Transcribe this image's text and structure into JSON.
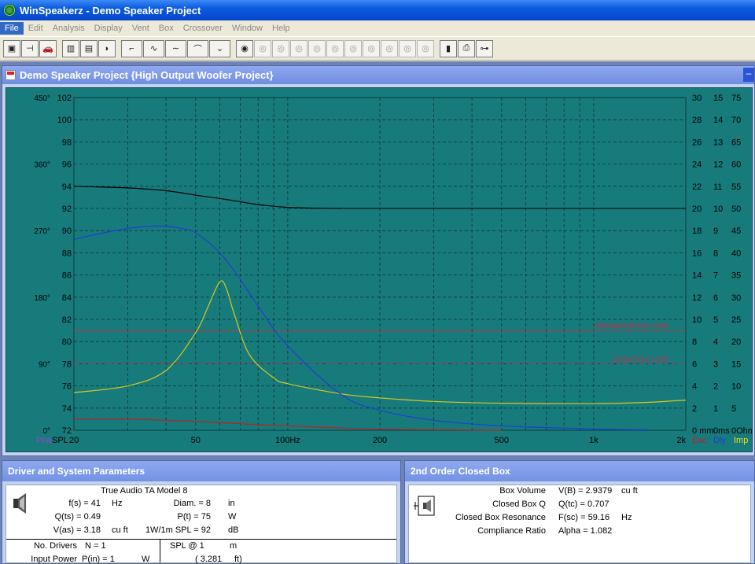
{
  "window": {
    "title": "WinSpeakerz - Demo Speaker Project"
  },
  "menu": [
    "File",
    "Edit",
    "Analysis",
    "Display",
    "Vent",
    "Box",
    "Crossover",
    "Window",
    "Help"
  ],
  "chart_window": {
    "title": "Demo Speaker Project {High Output Woofer Project}"
  },
  "chart_data": {
    "type": "line",
    "x_scale": "log",
    "xlim": [
      20,
      2000
    ],
    "x_ticks": [
      "20",
      "50",
      "100Hz",
      "200",
      "500",
      "1k",
      "2k"
    ],
    "ylim_spl": [
      72,
      102
    ],
    "y_ticks_spl": [
      "102",
      "100",
      "98",
      "96",
      "94",
      "92",
      "90",
      "88",
      "86",
      "84",
      "82",
      "80",
      "78",
      "76",
      "74",
      "72"
    ],
    "y_ticks_phase": [
      "450°",
      "360°",
      "270°",
      "180°",
      "90°",
      "0°"
    ],
    "y_ticks_exc": [
      "30",
      "28",
      "26",
      "24",
      "22",
      "20",
      "18",
      "16",
      "14",
      "12",
      "10",
      "8",
      "6",
      "4",
      "2",
      "0 mm"
    ],
    "y_ticks_dly": [
      "15",
      "14",
      "13",
      "12",
      "11",
      "10",
      "9",
      "8",
      "7",
      "6",
      "5",
      "4",
      "3",
      "2",
      "1",
      "0ms"
    ],
    "y_ticks_imp": [
      "75",
      "70",
      "65",
      "60",
      "55",
      "50",
      "45",
      "40",
      "35",
      "30",
      "25",
      "20",
      "15",
      "10",
      "5",
      "0Ohm"
    ],
    "axis_labels": {
      "phase": "Pha",
      "spl": "SPL",
      "exc": "Exc",
      "dly": "Dly",
      "imp": "Imp"
    },
    "series": [
      {
        "name": "SPL",
        "color": "#000000",
        "axis": "spl",
        "x": [
          20,
          30,
          40,
          50,
          60,
          70,
          80,
          90,
          100,
          120,
          150
        ],
        "y": [
          94.0,
          93.85,
          93.6,
          93.2,
          92.9,
          92.6,
          92.35,
          92.2,
          92.1,
          92.03,
          92.0
        ]
      },
      {
        "name": "Imp",
        "color": "#d8c81e",
        "axis": "imp",
        "x": [
          20,
          30,
          40,
          50,
          55,
          60,
          63,
          67,
          75,
          90,
          100,
          150,
          200,
          300,
          500,
          1000,
          1500,
          2000
        ],
        "y": [
          8.5,
          10.0,
          13.5,
          22.0,
          28.0,
          33.5,
          32.0,
          26.0,
          17.0,
          11.8,
          10.5,
          8.2,
          7.3,
          6.5,
          6.1,
          6.0,
          6.3,
          6.8
        ]
      },
      {
        "name": "Dly",
        "color": "#1f3fd6",
        "axis": "dly",
        "x": [
          20,
          25,
          30,
          35,
          40,
          45,
          50,
          60,
          70,
          80,
          100,
          150,
          200,
          300,
          500,
          1000,
          1500
        ],
        "y": [
          8.6,
          8.9,
          9.1,
          9.2,
          9.2,
          9.1,
          8.9,
          8.0,
          6.8,
          5.6,
          3.8,
          1.6,
          0.9,
          0.45,
          0.2,
          0.06,
          0.02
        ]
      },
      {
        "name": "Exc",
        "color": "#c02020",
        "axis": "exc",
        "x": [
          20,
          30,
          40,
          50,
          60,
          80,
          100,
          150,
          200,
          300,
          400,
          500
        ],
        "y": [
          1.0,
          1.0,
          0.9,
          0.8,
          0.7,
          0.5,
          0.4,
          0.2,
          0.1,
          0.04,
          0.02,
          0.0
        ]
      }
    ],
    "limit_lines": [
      {
        "label": "Mechanical Exc Limit",
        "axis": "exc",
        "value": 9.0,
        "color": "#c42f4a",
        "style": "solid"
      },
      {
        "label": "Linear Exc Limit",
        "axis": "exc",
        "value": 6.0,
        "color": "#c42f4a",
        "style": "dashed"
      }
    ]
  },
  "driver_panel": {
    "title": "Driver and System Parameters",
    "model": "True Audio TA Model 8",
    "fs": {
      "label": "f(s) = 41",
      "unit": "Hz"
    },
    "qts": {
      "label": "Q(ts) = 0.49"
    },
    "vas": {
      "label": "V(as) = 3.18",
      "unit": "cu ft"
    },
    "diam": {
      "label": "Diam. = 8",
      "unit": "in"
    },
    "pt": {
      "label": "P(t) = 75",
      "unit": "W"
    },
    "spl": {
      "label": "1W/1m SPL = 92",
      "unit": "dB"
    },
    "drivers": {
      "label": "No. Drivers",
      "value": "N = 1"
    },
    "power": {
      "label": "Input Power",
      "value": "P(in) = 1",
      "unit": "W"
    },
    "spl_at": {
      "label": "SPL @ 1",
      "unit": "m",
      "value": "( 3.281",
      "unit2": "ft)"
    }
  },
  "box_panel": {
    "title": "2nd Order Closed Box",
    "rows": [
      {
        "label": "Box Volume",
        "value": "V(B) = 2.9379",
        "unit": "cu ft"
      },
      {
        "label": "Closed Box Q",
        "value": "Q(tc) = 0.707",
        "unit": ""
      },
      {
        "label": "Closed Box Resonance",
        "value": "F(sc) = 59.16",
        "unit": "Hz"
      },
      {
        "label": "Compliance Ratio",
        "value": "Alpha = 1.082",
        "unit": ""
      }
    ]
  }
}
